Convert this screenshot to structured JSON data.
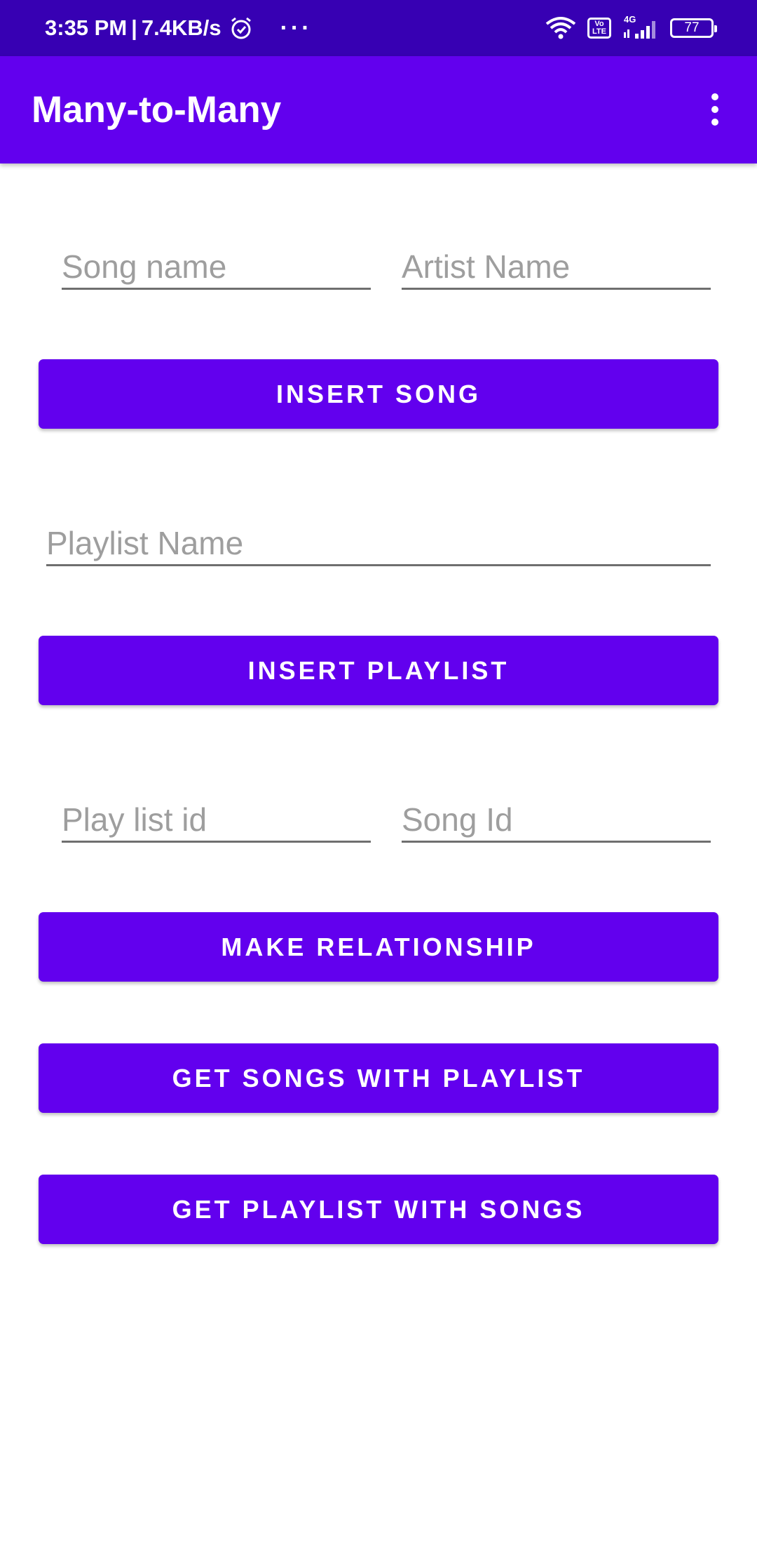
{
  "status_bar": {
    "time": "3:35 PM",
    "separator": "|",
    "speed": "7.4KB/s",
    "more": "···",
    "network_type": "4G",
    "volte_label": "Vo LTE",
    "battery": "77",
    "icons": [
      "alarm-icon",
      "wifi-icon",
      "volte-icon",
      "signal-icon",
      "battery-icon"
    ]
  },
  "app_bar": {
    "title": "Many-to-Many",
    "menu_icon": "more-vert-icon"
  },
  "form": {
    "song_name_placeholder": "Song name",
    "artist_name_placeholder": "Artist Name",
    "playlist_name_placeholder": "Playlist Name",
    "playlist_id_placeholder": "Play list id",
    "song_id_placeholder": "Song Id"
  },
  "buttons": {
    "insert_song": "INSERT SONG",
    "insert_playlist": "INSERT PLAYLIST",
    "make_relationship": "MAKE RELATIONSHIP",
    "get_songs_with_playlist": "GET SONGS WITH PLAYLIST",
    "get_playlist_with_songs": "GET PLAYLIST WITH SONGS"
  },
  "colors": {
    "status_bar": "#3700b3",
    "primary": "#6200ee",
    "on_primary": "#ffffff",
    "hint_text": "#9e9e9e",
    "underline": "#6f6f6f"
  }
}
